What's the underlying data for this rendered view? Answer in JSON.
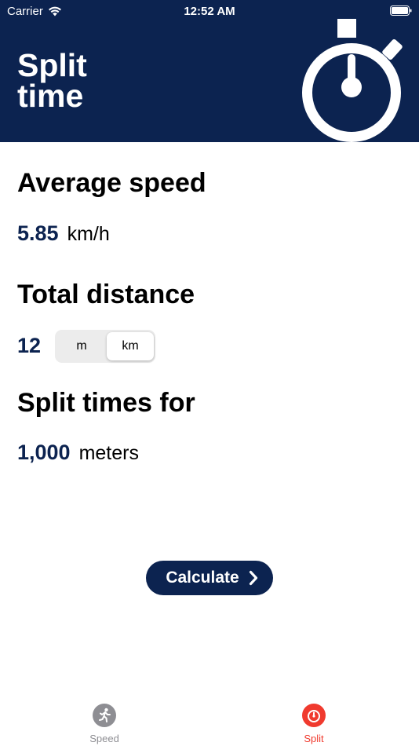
{
  "status_bar": {
    "carrier": "Carrier",
    "time": "12:52 AM"
  },
  "header": {
    "title_line1": "Split",
    "title_line2": "time",
    "icon": "stopwatch-icon"
  },
  "average_speed": {
    "title": "Average speed",
    "value": "5.85",
    "unit": "km/h"
  },
  "total_distance": {
    "title": "Total distance",
    "value": "12",
    "unit_options": [
      "m",
      "km"
    ],
    "selected_unit": "km"
  },
  "split_times": {
    "title": "Split times for",
    "value": "1,000",
    "unit": "meters"
  },
  "calculate_button": {
    "label": "Calculate",
    "icon": "chevron-right-icon"
  },
  "tab_bar": {
    "tabs": [
      {
        "label": "Speed",
        "icon": "runner-icon",
        "selected": false
      },
      {
        "label": "Split",
        "icon": "stopwatch-icon",
        "selected": true
      }
    ]
  },
  "colors": {
    "navy": "#0c2350",
    "accent_red": "#f03a2e",
    "tab_inactive": "#8e8e93",
    "segment_bg": "#ececec"
  }
}
